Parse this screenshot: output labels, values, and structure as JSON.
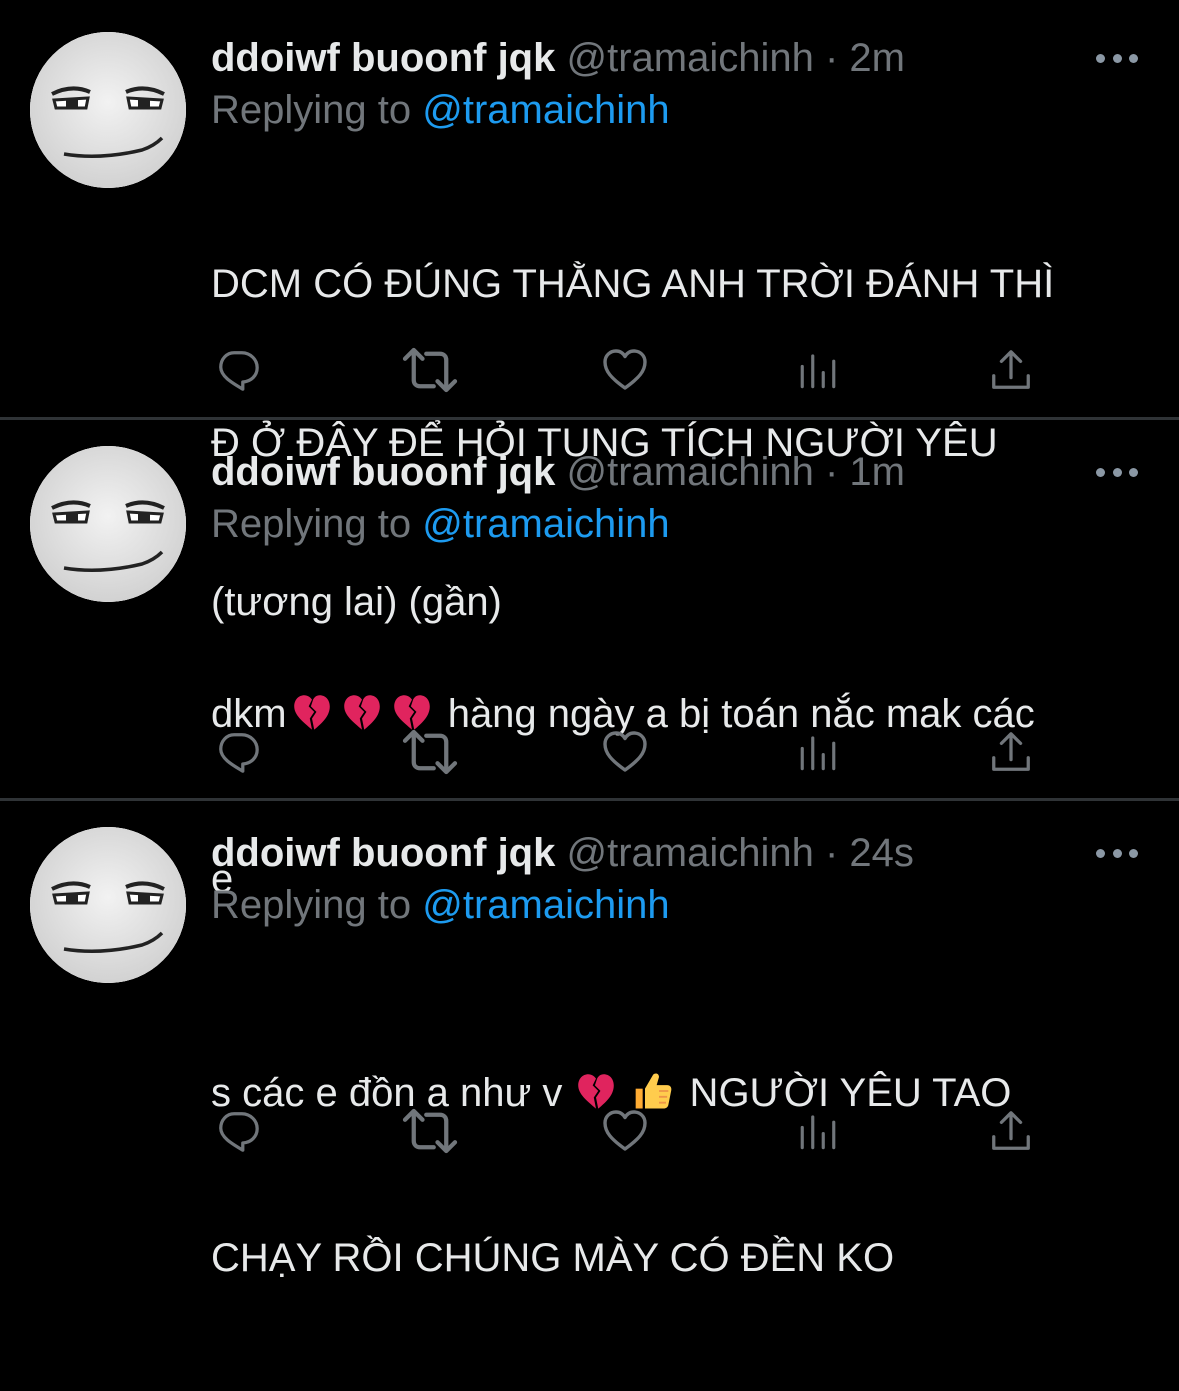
{
  "colors": {
    "background": "#000000",
    "divider": "#2f3336",
    "primary_text": "#e7e9ea",
    "secondary_text": "#71767b",
    "link": "#1d9bf0",
    "heartbreak_emoji": "#e0245e",
    "thumbs_up_emoji": "#ffcc4d"
  },
  "tweets": [
    {
      "display_name": "ddoiwf buoonf jqk",
      "handle": "@tramaichinh",
      "separator": " · ",
      "time": "2m",
      "replying_to_label": "Replying to ",
      "replying_to_handle": "@tramaichinh",
      "text_lines": [
        "DCM CÓ ĐÚNG THẰNG ANH TRỜI ĐÁNH THÌ",
        "Đ Ở ĐÂY ĐỂ HỎI TUNG TÍCH NGƯỜI YÊU",
        "(tương lai) (gần)"
      ],
      "actions": [
        "reply-icon",
        "retweet-icon",
        "like-icon",
        "analytics-icon",
        "share-icon"
      ]
    },
    {
      "display_name": "ddoiwf buoonf jqk",
      "handle": "@tramaichinh",
      "separator": " · ",
      "time": "1m",
      "replying_to_label": "Replying to ",
      "replying_to_handle": "@tramaichinh",
      "text_part1": "dkm",
      "text_part2": " hàng ngày a bị toán nắc mak các",
      "text_line2": "e",
      "emojis": [
        "broken-heart-emoji",
        "broken-heart-emoji",
        "broken-heart-emoji"
      ],
      "actions": [
        "reply-icon",
        "retweet-icon",
        "like-icon",
        "analytics-icon",
        "share-icon"
      ]
    },
    {
      "display_name": "ddoiwf buoonf jqk",
      "handle": "@tramaichinh",
      "separator": " · ",
      "time": "24s",
      "replying_to_label": "Replying to ",
      "replying_to_handle": "@tramaichinh",
      "text_part1": "s các e đồn a như v",
      "text_part2": " NGƯỜI YÊU TAO",
      "text_line2": "CHẠY RỒI CHÚNG MÀY CÓ ĐỀN KO",
      "emojis": [
        "broken-heart-emoji",
        "thumbs-up-emoji"
      ],
      "actions": [
        "reply-icon",
        "retweet-icon",
        "like-icon",
        "analytics-icon",
        "share-icon"
      ]
    }
  ]
}
